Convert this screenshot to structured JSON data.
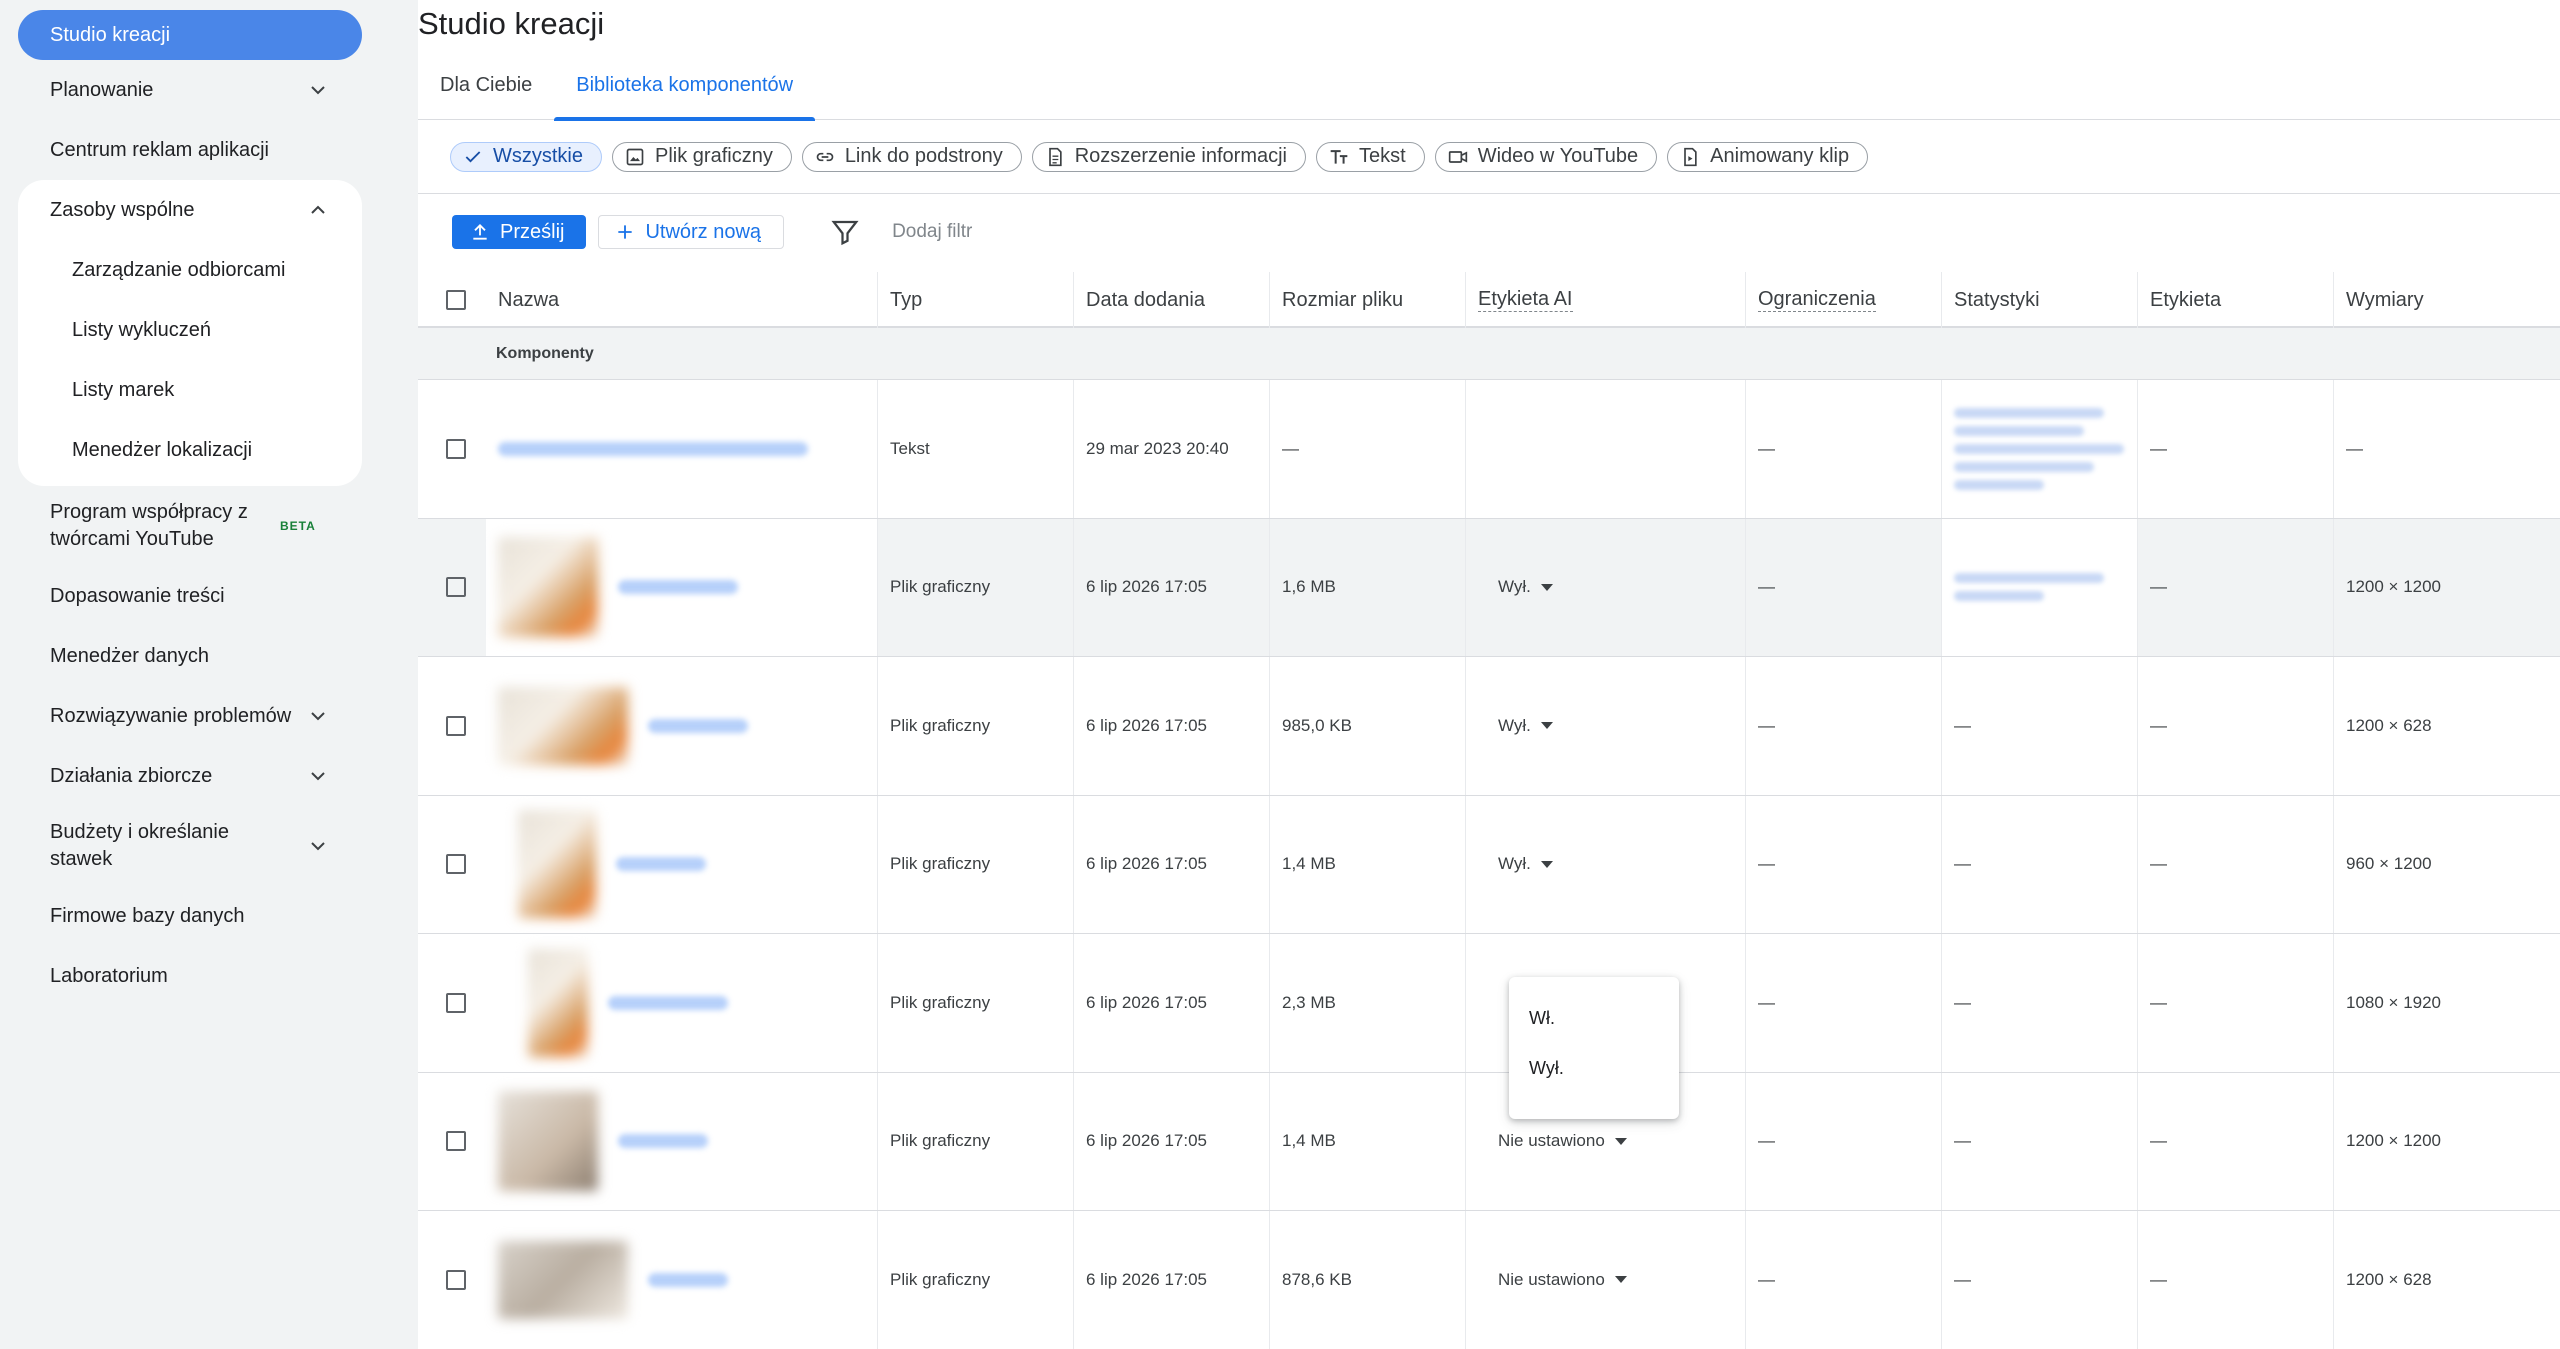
{
  "sidebar": {
    "active": "Studio kreacji",
    "items": [
      {
        "label": "Planowanie"
      },
      {
        "label": "Centrum reklam aplikacji"
      },
      {
        "label": "Zasoby wspólne"
      },
      {
        "label": "Program współpracy z twórcami YouTube",
        "badge": "BETA"
      },
      {
        "label": "Dopasowanie treści"
      },
      {
        "label": "Menedżer danych"
      },
      {
        "label": "Rozwiązywanie problemów"
      },
      {
        "label": "Działania zbiorcze"
      },
      {
        "label": "Budżety i określanie stawek"
      },
      {
        "label": "Firmowe bazy danych"
      },
      {
        "label": "Laboratorium"
      }
    ],
    "sub_items": [
      "Zarządzanie odbiorcami",
      "Listy wykluczeń",
      "Listy marek",
      "Menedżer lokalizacji"
    ]
  },
  "main": {
    "title": "Studio kreacji",
    "tabs": [
      "Dla Ciebie",
      "Biblioteka komponentów"
    ],
    "chips": [
      "Wszystkie",
      "Plik graficzny",
      "Link do podstrony",
      "Rozszerzenie informacji",
      "Tekst",
      "Wideo w YouTube",
      "Animowany klip"
    ],
    "toolbar": {
      "upload": "Prześlij",
      "create": "Utwórz nową",
      "add_filter": "Dodaj filtr"
    },
    "columns": [
      "Nazwa",
      "Typ",
      "Data dodania",
      "Rozmiar pliku",
      "Etykieta AI",
      "Ograniczenia",
      "Statystyki",
      "Etykieta",
      "Wymiary"
    ],
    "group_label": "Komponenty",
    "rows": [
      {
        "type": "Tekst",
        "date": "29 mar 2023 20:40",
        "size": "—",
        "ai": "",
        "restrictions": "—",
        "label": "—",
        "dims": "—"
      },
      {
        "type": "Plik graficzny",
        "date": "6 lip 2026 17:05",
        "size": "1,6 MB",
        "ai": "Wył.",
        "restrictions": "—",
        "label": "—",
        "dims": "1200 × 1200"
      },
      {
        "type": "Plik graficzny",
        "date": "6 lip 2026 17:05",
        "size": "985,0 KB",
        "ai": "Wył.",
        "restrictions": "—",
        "stats": "—",
        "label": "—",
        "dims": "1200 × 628"
      },
      {
        "type": "Plik graficzny",
        "date": "6 lip 2026 17:05",
        "size": "1,4 MB",
        "ai": "Wył.",
        "restrictions": "—",
        "stats": "—",
        "label": "—",
        "dims": "960 × 1200"
      },
      {
        "type": "Plik graficzny",
        "date": "6 lip 2026 17:05",
        "size": "2,3 MB",
        "ai": "",
        "restrictions": "—",
        "stats": "—",
        "label": "—",
        "dims": "1080 × 1920"
      },
      {
        "type": "Plik graficzny",
        "date": "6 lip 2026 17:05",
        "size": "1,4 MB",
        "ai": "Nie ustawiono",
        "restrictions": "—",
        "stats": "—",
        "label": "—",
        "dims": "1200 × 1200"
      },
      {
        "type": "Plik graficzny",
        "date": "6 lip 2026 17:05",
        "size": "878,6 KB",
        "ai": "Nie ustawiono",
        "restrictions": "—",
        "stats": "—",
        "label": "—",
        "dims": "1200 × 628"
      }
    ],
    "popup": [
      "Wł.",
      "Wył."
    ]
  }
}
